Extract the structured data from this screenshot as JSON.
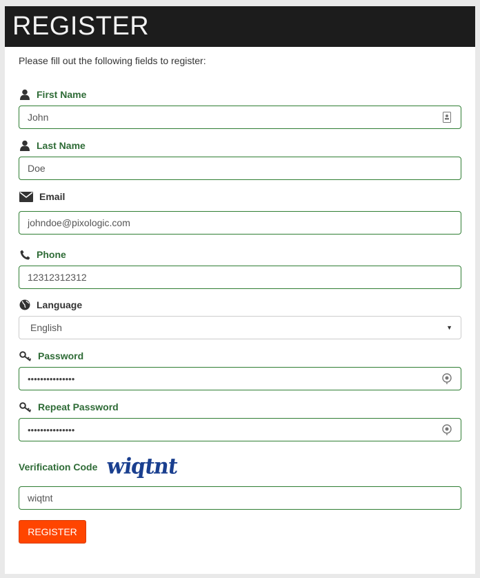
{
  "header": {
    "title": "REGISTER"
  },
  "intro": "Please fill out the following fields to register:",
  "fields": {
    "first_name": {
      "label": "First Name",
      "value": "John",
      "icon": "user-icon",
      "suffix_icon": "contact-card-icon"
    },
    "last_name": {
      "label": "Last Name",
      "value": "Doe",
      "icon": "user-icon"
    },
    "email": {
      "label": "Email",
      "value": "johndoe@pixologic.com",
      "icon": "envelope-icon"
    },
    "phone": {
      "label": "Phone",
      "value": "12312312312",
      "icon": "phone-icon"
    },
    "language": {
      "label": "Language",
      "selected": "English",
      "icon": "globe-icon"
    },
    "password": {
      "label": "Password",
      "value": "•••••••••••••••",
      "icon": "key-icon",
      "suffix_icon": "password-reveal-icon"
    },
    "repeat_password": {
      "label": "Repeat Password",
      "value": "•••••••••••••••",
      "icon": "key-icon",
      "suffix_icon": "password-reveal-icon"
    },
    "verification": {
      "label": "Verification Code",
      "captcha_text": "wiqtnt",
      "value": "wiqtnt"
    }
  },
  "register_button": {
    "label": "REGISTER"
  },
  "colors": {
    "header_bg": "#1c1c1c",
    "label_green": "#2e6b36",
    "input_border": "#2e7d32",
    "button_bg": "#ff4500",
    "captcha_blue": "#1a3f8f"
  }
}
